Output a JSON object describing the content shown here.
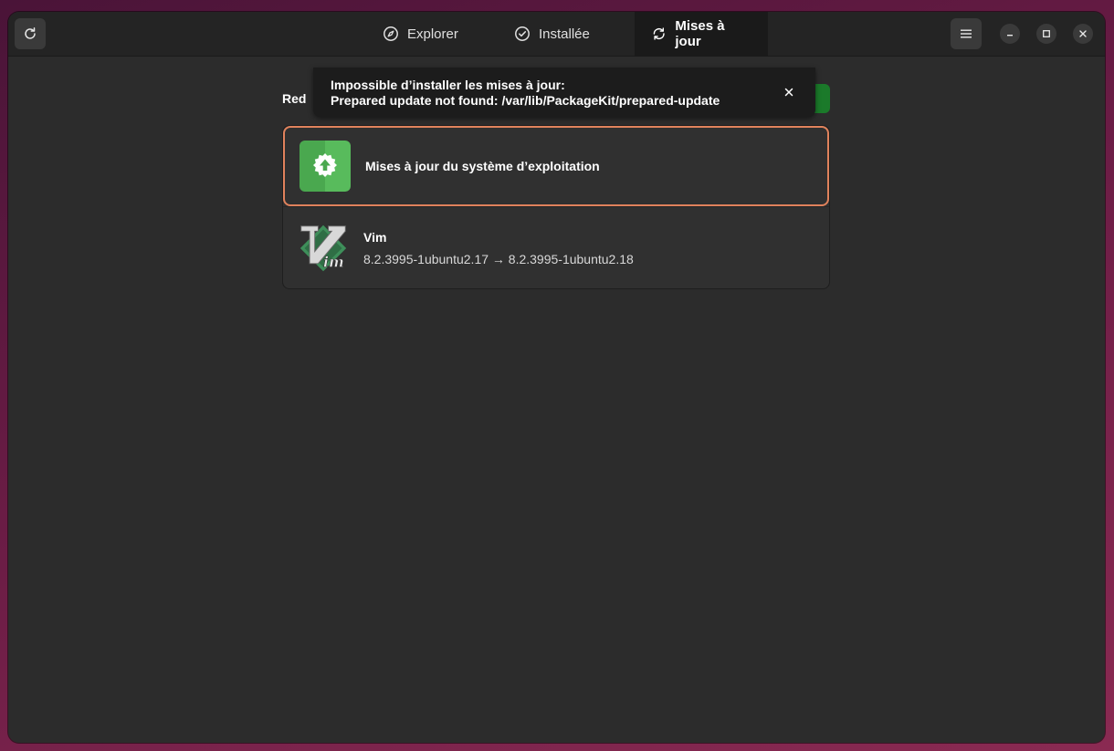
{
  "tabs": [
    {
      "label": "Explorer",
      "icon": "compass-icon"
    },
    {
      "label": "Installée",
      "icon": "check-circle-icon"
    },
    {
      "label": "Mises à jour",
      "icon": "refresh-icon"
    }
  ],
  "active_tab": "Mises à jour",
  "header_buttons": {
    "refresh_icon": "refresh-icon",
    "menu_icon": "hamburger-menu-icon",
    "minimize_icon": "minimize-icon",
    "maximize_icon": "maximize-icon",
    "close_icon": "close-icon"
  },
  "toast": {
    "line1": "Impossible d’installer les mises à jour:",
    "line2": "Prepared update not found: /var/lib/PackageKit/prepared-update",
    "close_icon": "close-icon"
  },
  "section": {
    "title": "Red",
    "action_label": ""
  },
  "updates": [
    {
      "title": "Mises à jour du système d’exploitation",
      "subtitle": "",
      "icon": "os-update-icon"
    },
    {
      "title": "Vim",
      "subtitle": "8.2.3995-1ubuntu2.17 → 8.2.3995-1ubuntu2.18",
      "icon": "vim-icon"
    }
  ],
  "colors": {
    "accent_green": "#1b7a2a",
    "selection_outline": "#e0825c",
    "window_bg": "#2c2c2c",
    "headerbar_bg": "#242424"
  }
}
